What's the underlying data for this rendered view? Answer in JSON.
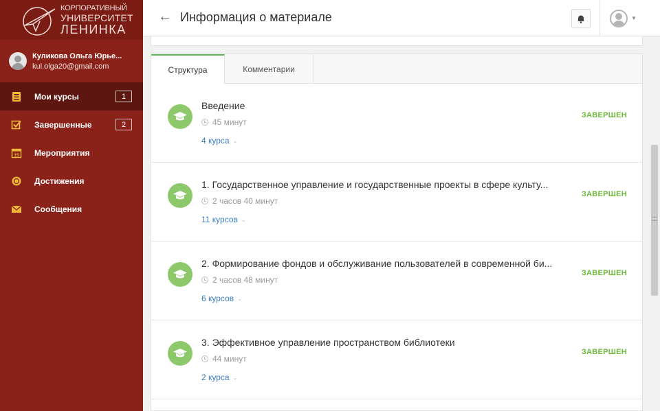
{
  "sidebar": {
    "logo": {
      "line1": "Корпоративный",
      "line2": "Университет",
      "line3": "Ленинка"
    },
    "user": {
      "name": "Куликова Ольга Юрье...",
      "email": "kul.olga20@gmail.com"
    },
    "items": [
      {
        "label": "Мои курсы",
        "icon": "document-list-icon",
        "badge": "1",
        "active": true
      },
      {
        "label": "Завершенные",
        "icon": "checkbox-icon",
        "badge": "2"
      },
      {
        "label": "Мероприятия",
        "icon": "calendar-icon"
      },
      {
        "label": "Достижения",
        "icon": "medal-icon"
      },
      {
        "label": "Сообщения",
        "icon": "envelope-icon"
      }
    ]
  },
  "header": {
    "title": "Информация о материале"
  },
  "tabs": [
    {
      "label": "Структура",
      "active": true
    },
    {
      "label": "Комментарии"
    }
  ],
  "modules": [
    {
      "title": "Введение",
      "duration": "45 минут",
      "courses": "4 курса",
      "status": "ЗАВЕРШЕН"
    },
    {
      "title": "1. Государственное управление и государственные проекты в сфере культу...",
      "duration": "2 часов 40 минут",
      "courses": "11 курсов",
      "status": "ЗАВЕРШЕН"
    },
    {
      "title": "2. Формирование фондов и обслуживание пользователей в современной би...",
      "duration": "2 часов 48 минут",
      "courses": "6 курсов",
      "status": "ЗАВЕРШЕН"
    },
    {
      "title": "3. Эффективное управление пространством библиотеки",
      "duration": "44 минут",
      "courses": "2 курса",
      "status": "ЗАВЕРШЕН"
    }
  ],
  "colors": {
    "sidebar": "#8b2219",
    "sidebar_active": "#5e1610",
    "accent_green": "#6cb83a",
    "link_blue": "#3a7cc0"
  }
}
